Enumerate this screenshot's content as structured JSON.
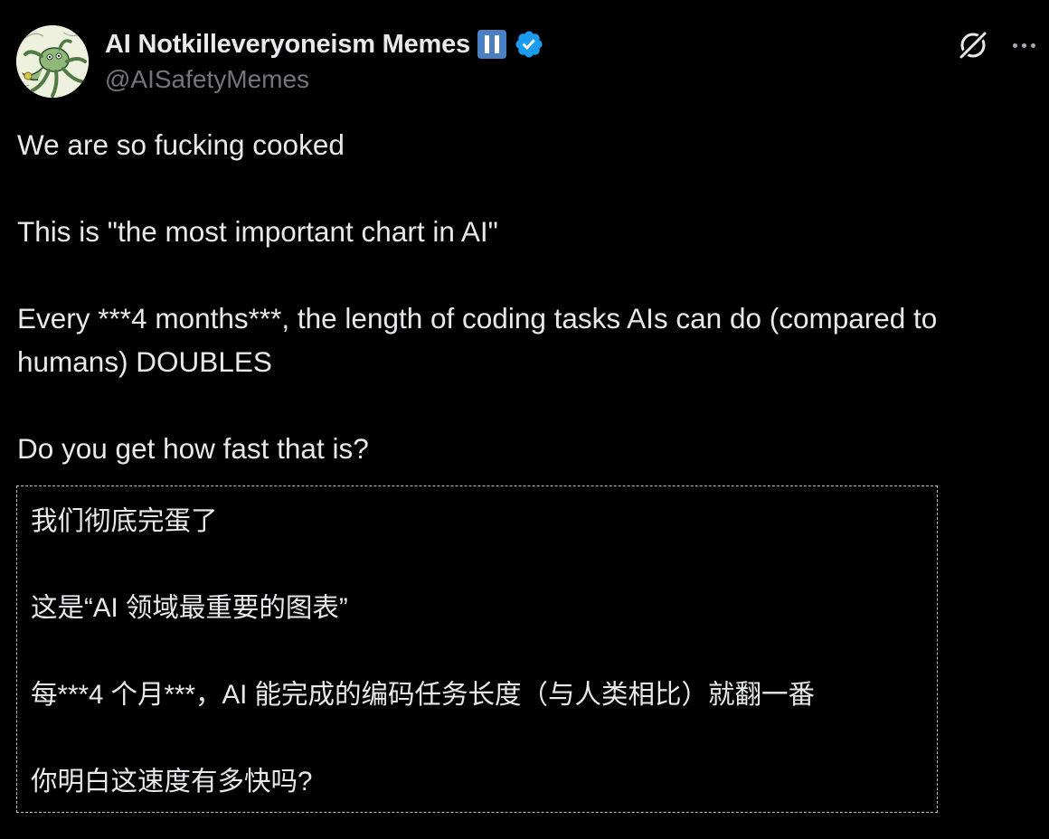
{
  "author": {
    "display_name": "AI Notkilleveryoneism Memes",
    "handle": "@AISafetyMemes",
    "avatar_icon": "tentacle-creature-avatar",
    "badges": [
      "pause-badge",
      "verified-badge"
    ],
    "verified_color": "#1d9bf0",
    "pause_badge_color": "#4a7fc1"
  },
  "header_actions": {
    "grok_icon": "grok-icon",
    "more_icon": "more-options-icon"
  },
  "tweet": {
    "paragraphs": [
      "We are so fucking cooked",
      "This is \"the most important chart in AI\"",
      "Every ***4 months***, the length of coding tasks AIs can do (compared to humans) DOUBLES",
      "Do you get how fast that is?"
    ]
  },
  "translation": {
    "paragraphs": [
      "我们彻底完蛋了",
      "这是“AI 领域最重要的图表”",
      "每***4 个月***，AI 能完成的编码任务长度（与人类相比）就翻一番",
      "你明白这速度有多快吗?"
    ]
  },
  "colors": {
    "background": "#000000",
    "primary_text": "#e7e9ea",
    "secondary_text": "#71767b"
  }
}
